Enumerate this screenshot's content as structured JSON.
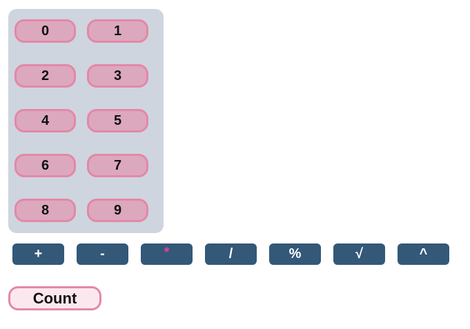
{
  "keypad": {
    "digits": [
      "0",
      "1",
      "2",
      "3",
      "4",
      "5",
      "6",
      "7",
      "8",
      "9"
    ]
  },
  "operators": [
    {
      "label": "+"
    },
    {
      "label": "-"
    },
    {
      "label": "*"
    },
    {
      "label": "/"
    },
    {
      "label": "%"
    },
    {
      "label": "√"
    },
    {
      "label": "^"
    }
  ],
  "count_button": {
    "label": "Count"
  },
  "colors": {
    "keypad_background": "#ced5de",
    "digit_button_fill": "#dca8bd",
    "digit_button_border": "#e487a8",
    "operator_button_fill": "#335878",
    "operator_text": "#ffffff",
    "multiply_text": "#e0459a",
    "count_button_fill": "#fbe8ee"
  }
}
